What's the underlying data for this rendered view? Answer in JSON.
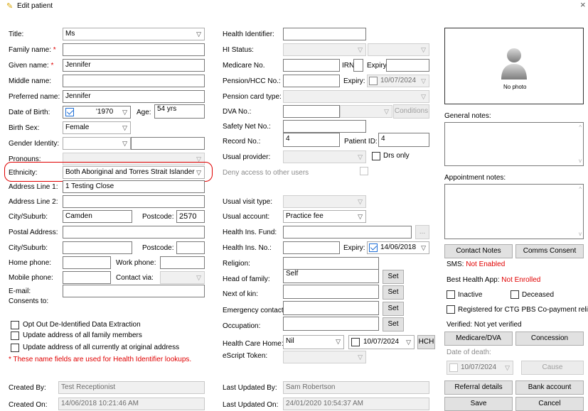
{
  "window": {
    "title": "Edit patient",
    "close": "×"
  },
  "left": {
    "title_label": "Title:",
    "title_value": "Ms",
    "family_label": "Family name:",
    "family_value": "",
    "given_label": "Given name:",
    "given_value": "Jennifer",
    "middle_label": "Middle name:",
    "middle_value": "",
    "preferred_label": "Preferred name:",
    "preferred_value": "Jennifer",
    "dob_label": "Date of Birth:",
    "dob_value": "'1970",
    "age_label": "Age:",
    "age_value": "54 yrs",
    "birthsex_label": "Birth Sex:",
    "birthsex_value": "Female",
    "gender_label": "Gender Identity:",
    "gender_value": "",
    "pronouns_label": "Pronouns:",
    "pronouns_value": "",
    "ethnicity_label": "Ethnicity:",
    "ethnicity_value": "Both Aboriginal and Torres Strait Islander",
    "addr1_label": "Address Line 1:",
    "addr1_value": "1 Testing Close",
    "addr2_label": "Address Line 2:",
    "addr2_value": "",
    "city_label": "City/Suburb:",
    "city_value": "Camden",
    "postcode_label": "Postcode:",
    "postcode_value": "2570",
    "postal_label": "Postal Address:",
    "postal_value": "",
    "city2_label": "City/Suburb:",
    "city2_value": "",
    "postcode2_label": "Postcode:",
    "postcode2_value": "",
    "homephone_label": "Home phone:",
    "homephone_value": "",
    "workphone_label": "Work phone:",
    "workphone_value": "",
    "mobile_label": "Mobile phone:",
    "mobile_value": "",
    "contactvia_label": "Contact via:",
    "contactvia_value": "",
    "email_label": "E-mail:",
    "email_value": "",
    "consents_label": "Consents to:",
    "optout_label": "Opt Out De-Identified Data Extraction",
    "updfamily_label": "Update address of all family members",
    "updall_label": "Update address of all currently at original address",
    "note_text": "* These name fields are used for Health Identifier lookups.",
    "required_mark": "*"
  },
  "middle": {
    "hi_label": "Health Identifier:",
    "hi_value": "",
    "histatus_label": "HI Status:",
    "medicare_label": "Medicare No.",
    "medicare_value": "",
    "irn_label": "IRN:",
    "expiry_label": "Expiry:",
    "pension_label": "Pension/HCC No.:",
    "pension_expiry_label": "Expiry:",
    "pension_expiry_value": "10/07/2024",
    "pensiontype_label": "Pension card type:",
    "dva_label": "DVA No.:",
    "conditions_label": "Conditions",
    "safety_label": "Safety Net No.:",
    "record_label": "Record No.:",
    "record_value": "4",
    "patientid_label": "Patient ID:",
    "patientid_value": "4",
    "provider_label": "Usual provider:",
    "drsonly_label": "Drs only",
    "deny_label": "Deny access to other users",
    "visittype_label": "Usual visit type:",
    "account_label": "Usual account:",
    "account_value": "Practice fee",
    "fund_label": "Health Ins. Fund:",
    "ellipsis": "...",
    "insno_label": "Health Ins. No.:",
    "ins_expiry_label": "Expiry:",
    "ins_expiry_value": "14/06/2018",
    "religion_label": "Religion:",
    "head_label": "Head of family:",
    "head_value": "Self",
    "nok_label": "Next of kin:",
    "emergency_label": "Emergency contact:",
    "occupation_label": "Occupation:",
    "set_label": "Set",
    "hch_label": "Health Care Home:",
    "hch_value": "Nil",
    "hch_date": "10/07/2024",
    "hch_button": "HCH",
    "escript_label": "eScript Token:"
  },
  "right": {
    "nophoto": "No photo",
    "general_notes_label": "General notes:",
    "appt_notes_label": "Appointment notes:",
    "contact_notes_button": "Contact Notes",
    "comms_consent_button": "Comms Consent",
    "sms_label": "SMS:",
    "sms_status": "Not Enabled",
    "bha_label": "Best Health App:",
    "bha_status": "Not Enrolled",
    "inactive_label": "Inactive",
    "deceased_label": "Deceased",
    "ctg_label": "Registered for CTG PBS Co-payment relief",
    "verified_label": "Verified: Not yet verified",
    "medicare_dva_button": "Medicare/DVA",
    "concession_button": "Concession",
    "dod_label": "Date of death:",
    "dod_value": "10/07/2024",
    "cause_button": "Cause",
    "referral_button": "Referral details",
    "bank_button": "Bank account",
    "save_button": "Save",
    "cancel_button": "Cancel"
  },
  "footer": {
    "created_by_label": "Created By:",
    "created_by_value": "Test Receptionist",
    "created_on_label": "Created On:",
    "created_on_value": "14/06/2018 10:21:46 AM",
    "updated_by_label": "Last Updated By:",
    "updated_by_value": "Sam Robertson",
    "updated_on_label": "Last Updated On:",
    "updated_on_value": "24/01/2020 10:54:37 AM"
  },
  "colors": {
    "highlight": "#e00000",
    "accent": "#1f6fd6"
  }
}
